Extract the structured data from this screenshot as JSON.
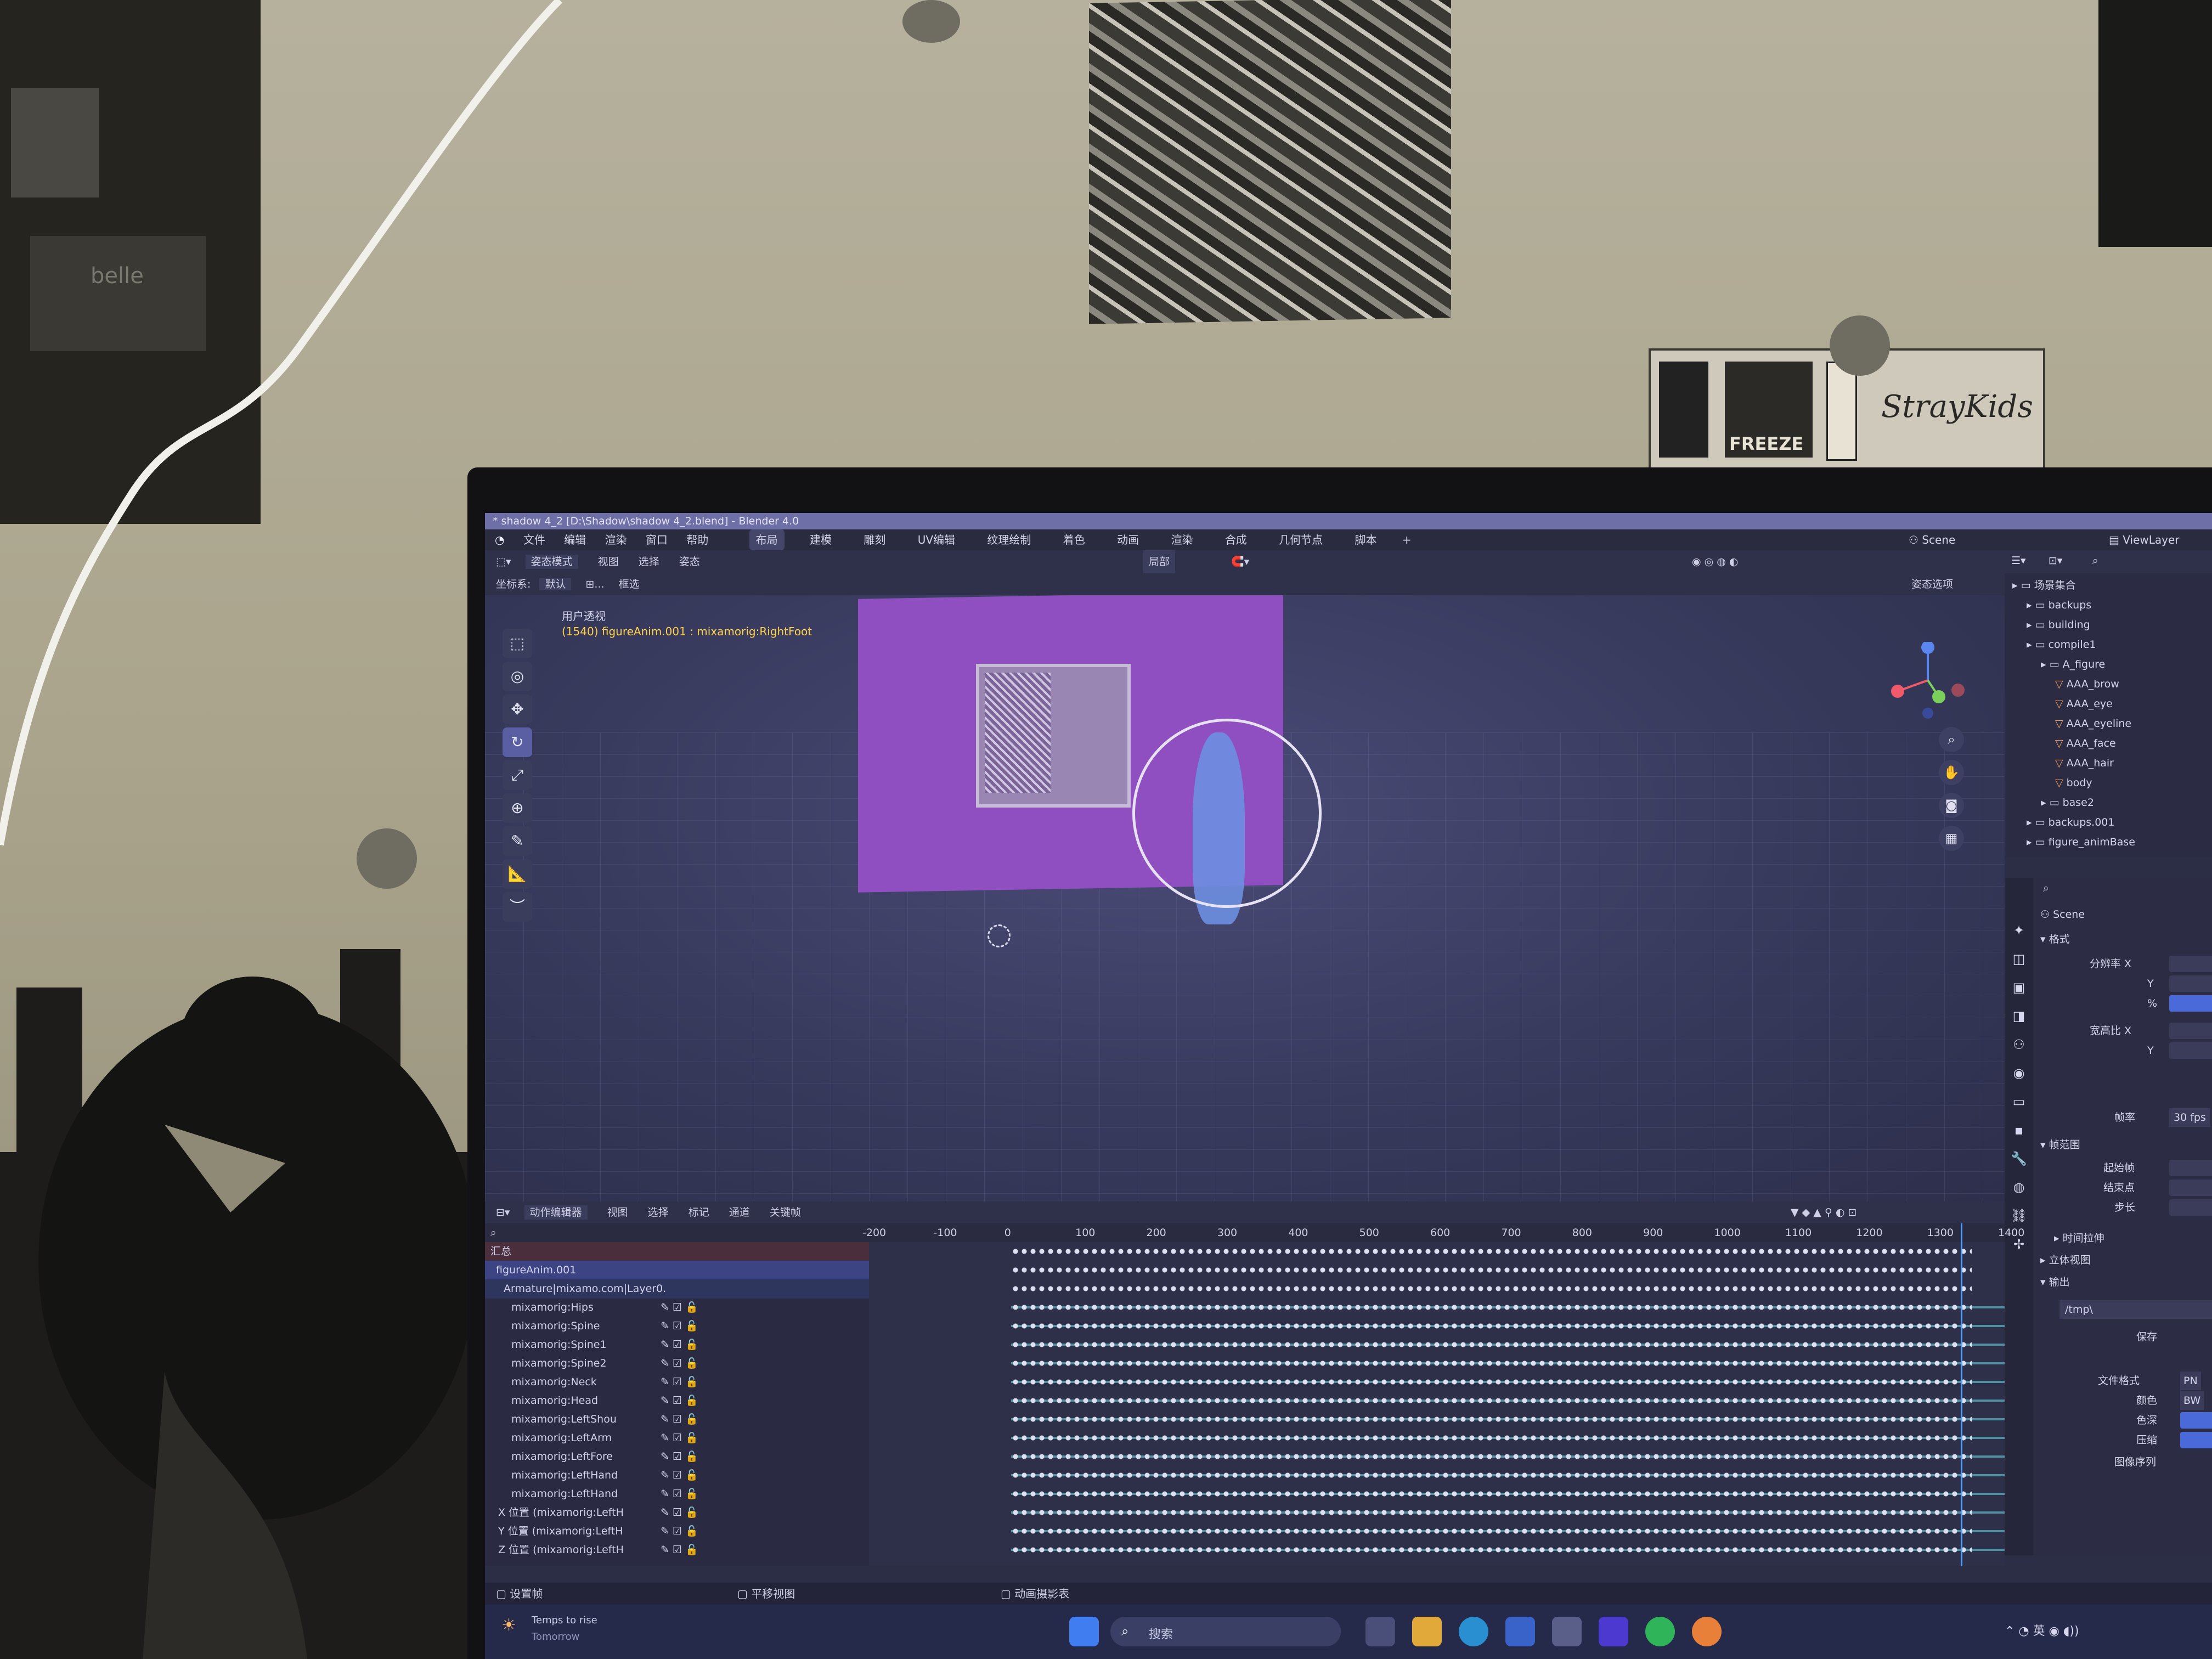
{
  "titlebar": {
    "text": "* shadow 4_2 [D:\\Shadow\\shadow 4_2.blend] - Blender 4.0"
  },
  "menubar": {
    "menus": [
      "文件",
      "编辑",
      "渲染",
      "窗口",
      "帮助"
    ],
    "workspaces": [
      "布局",
      "建模",
      "雕刻",
      "UV编辑",
      "纹理绘制",
      "着色",
      "动画",
      "渲染",
      "合成",
      "几何节点",
      "脚本"
    ],
    "add_tab": "+",
    "scene_label": "Scene",
    "viewlayer_label": "ViewLayer"
  },
  "viewport_header": {
    "mode": "姿态模式",
    "menus": [
      "视图",
      "选择",
      "姿态"
    ],
    "pivot": "局部",
    "coord_label": "坐标系:",
    "coord_value": "默认",
    "snap_label": "⊞...",
    "drag_label": "框选",
    "options_label": "姿态选项"
  },
  "viewport": {
    "view_name": "用户透视",
    "info": "(1540) figureAnim.001 : mixamorig:RightFoot",
    "tools": [
      "⬚",
      "◎",
      "✥",
      "↻",
      "⤢",
      "⊕",
      "✎",
      "📐",
      "︶"
    ]
  },
  "outliner": {
    "rows": [
      {
        "indent": 0,
        "label": "场景集合"
      },
      {
        "indent": 1,
        "label": "backups"
      },
      {
        "indent": 1,
        "label": "building"
      },
      {
        "indent": 1,
        "label": "compile1"
      },
      {
        "indent": 2,
        "label": "A_figure"
      },
      {
        "indent": 3,
        "label": "AAA_brow"
      },
      {
        "indent": 3,
        "label": "AAA_eye"
      },
      {
        "indent": 3,
        "label": "AAA_eyeline"
      },
      {
        "indent": 3,
        "label": "AAA_face"
      },
      {
        "indent": 3,
        "label": "AAA_hair"
      },
      {
        "indent": 3,
        "label": "body"
      },
      {
        "indent": 2,
        "label": "base2"
      },
      {
        "indent": 1,
        "label": "backups.001"
      },
      {
        "indent": 1,
        "label": "figure_animBase"
      }
    ]
  },
  "properties": {
    "scene": "Scene",
    "format_section": "格式",
    "res_x": "分辨率 X",
    "res_y": "Y",
    "res_pct": "%",
    "aspect_x": "宽高比 X",
    "aspect_y": "Y",
    "framerate_label": "帧率",
    "framerate_value": "30 fps",
    "frame_range_section": "帧范围",
    "start_label": "起始帧",
    "end_label": "结束点",
    "step_label": "步长",
    "time_stretch": "时间拉伸",
    "stereo": "立体视图",
    "output_section": "输出",
    "output_path": "/tmp\\",
    "save_label": "保存",
    "file_format_label": "文件格式",
    "color_label": "颜色",
    "color_depth_label": "色深",
    "compression_label": "压缩",
    "image_seq_label": "图像序列",
    "file_format_value": "PN",
    "color_value": "BW"
  },
  "dopesheet": {
    "mode": "动作编辑器",
    "menus": [
      "视图",
      "选择",
      "标记",
      "通道",
      "关键帧"
    ],
    "ruler": [
      "-200",
      "-100",
      "0",
      "100",
      "200",
      "300",
      "400",
      "500",
      "600",
      "700",
      "800",
      "900",
      "1000",
      "1100",
      "1200",
      "1300",
      "1400"
    ],
    "channels": [
      {
        "label": "汇总",
        "kind": "sum"
      },
      {
        "label": "figureAnim.001",
        "kind": "obj"
      },
      {
        "label": "Armature|mixamo.com|Layer0.",
        "kind": "arm"
      },
      {
        "label": "mixamorig:Hips",
        "kind": "bone"
      },
      {
        "label": "mixamorig:Spine",
        "kind": "bone"
      },
      {
        "label": "mixamorig:Spine1",
        "kind": "bone"
      },
      {
        "label": "mixamorig:Spine2",
        "kind": "bone"
      },
      {
        "label": "mixamorig:Neck",
        "kind": "bone"
      },
      {
        "label": "mixamorig:Head",
        "kind": "bone"
      },
      {
        "label": "mixamorig:LeftShou",
        "kind": "bone"
      },
      {
        "label": "mixamorig:LeftArm",
        "kind": "bone"
      },
      {
        "label": "mixamorig:LeftFore",
        "kind": "bone"
      },
      {
        "label": "mixamorig:LeftHand",
        "kind": "bone"
      },
      {
        "label": "mixamorig:LeftHand",
        "kind": "bone"
      },
      {
        "label": "X 位置 (mixamorig:LeftH",
        "kind": "curve"
      },
      {
        "label": "Y 位置 (mixamorig:LeftH",
        "kind": "curve"
      },
      {
        "label": "Z 位置 (mixamorig:LeftH",
        "kind": "curve"
      }
    ]
  },
  "statusbar": {
    "left": "设置帧",
    "mid": "平移视图",
    "right": "动画摄影表"
  },
  "taskbar": {
    "weather_line1": "Temps to rise",
    "weather_line2": "Tomorrow",
    "search_placeholder": "搜索",
    "tray_lang": "英"
  },
  "room": {
    "sticker_word": "FREEZE",
    "sticker_script": "StrayKids",
    "poster_word": "belle"
  }
}
